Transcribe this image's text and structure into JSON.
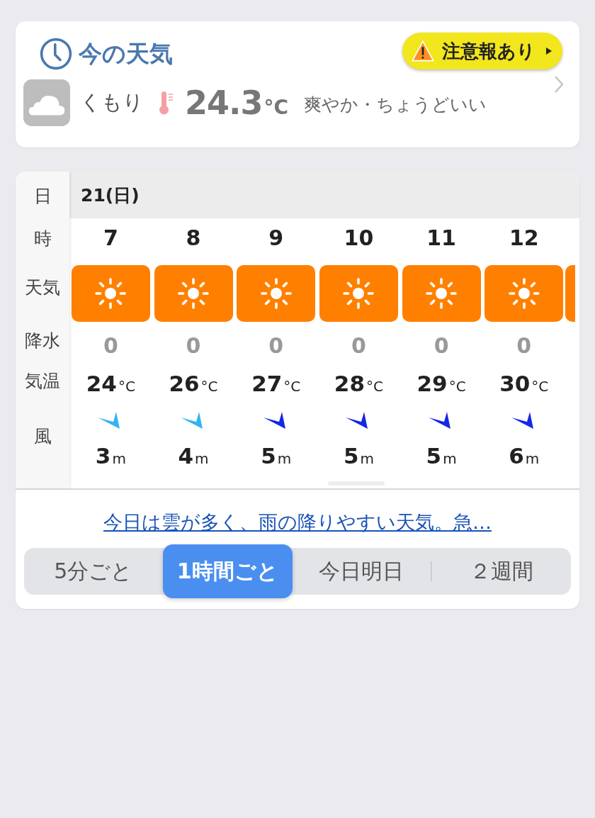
{
  "current": {
    "title": "今の天気",
    "alert": {
      "label": "注意報あり"
    },
    "condition": "くもり",
    "temperature": "24.3",
    "temp_unit": "°C",
    "feel": "爽やか・ちょうどいい"
  },
  "forecast": {
    "row_labels": [
      "日",
      "時",
      "天気",
      "降水",
      "気温",
      "風"
    ],
    "date": "21(日)",
    "hours": [
      {
        "hour": "7",
        "kind": "sunny",
        "precip": "0",
        "temp": "24",
        "temp_unit": "°C",
        "wind": {
          "color": "#33b4f0",
          "speed": "3",
          "unit": "m"
        }
      },
      {
        "hour": "8",
        "kind": "sunny",
        "precip": "0",
        "temp": "26",
        "temp_unit": "°C",
        "wind": {
          "color": "#33b4f0",
          "speed": "4",
          "unit": "m"
        }
      },
      {
        "hour": "9",
        "kind": "sunny",
        "precip": "0",
        "temp": "27",
        "temp_unit": "°C",
        "wind": {
          "color": "#1428e6",
          "speed": "5",
          "unit": "m"
        }
      },
      {
        "hour": "10",
        "kind": "sunny",
        "precip": "0",
        "temp": "28",
        "temp_unit": "°C",
        "wind": {
          "color": "#1428e6",
          "speed": "5",
          "unit": "m"
        }
      },
      {
        "hour": "11",
        "kind": "sunny",
        "precip": "0",
        "temp": "29",
        "temp_unit": "°C",
        "wind": {
          "color": "#1428e6",
          "speed": "5",
          "unit": "m"
        }
      },
      {
        "hour": "12",
        "kind": "sunny",
        "precip": "0",
        "temp": "30",
        "temp_unit": "°C",
        "wind": {
          "color": "#1428e6",
          "speed": "6",
          "unit": "m"
        }
      }
    ],
    "summary_link": "今日は雲が多く、雨の降りやすい天気。急…",
    "tabs": [
      {
        "label": "5分ごと",
        "selected": false
      },
      {
        "label": "1時間ごと",
        "selected": true
      },
      {
        "label": "今日明日",
        "selected": false
      },
      {
        "label": "２週間",
        "selected": false
      }
    ]
  }
}
